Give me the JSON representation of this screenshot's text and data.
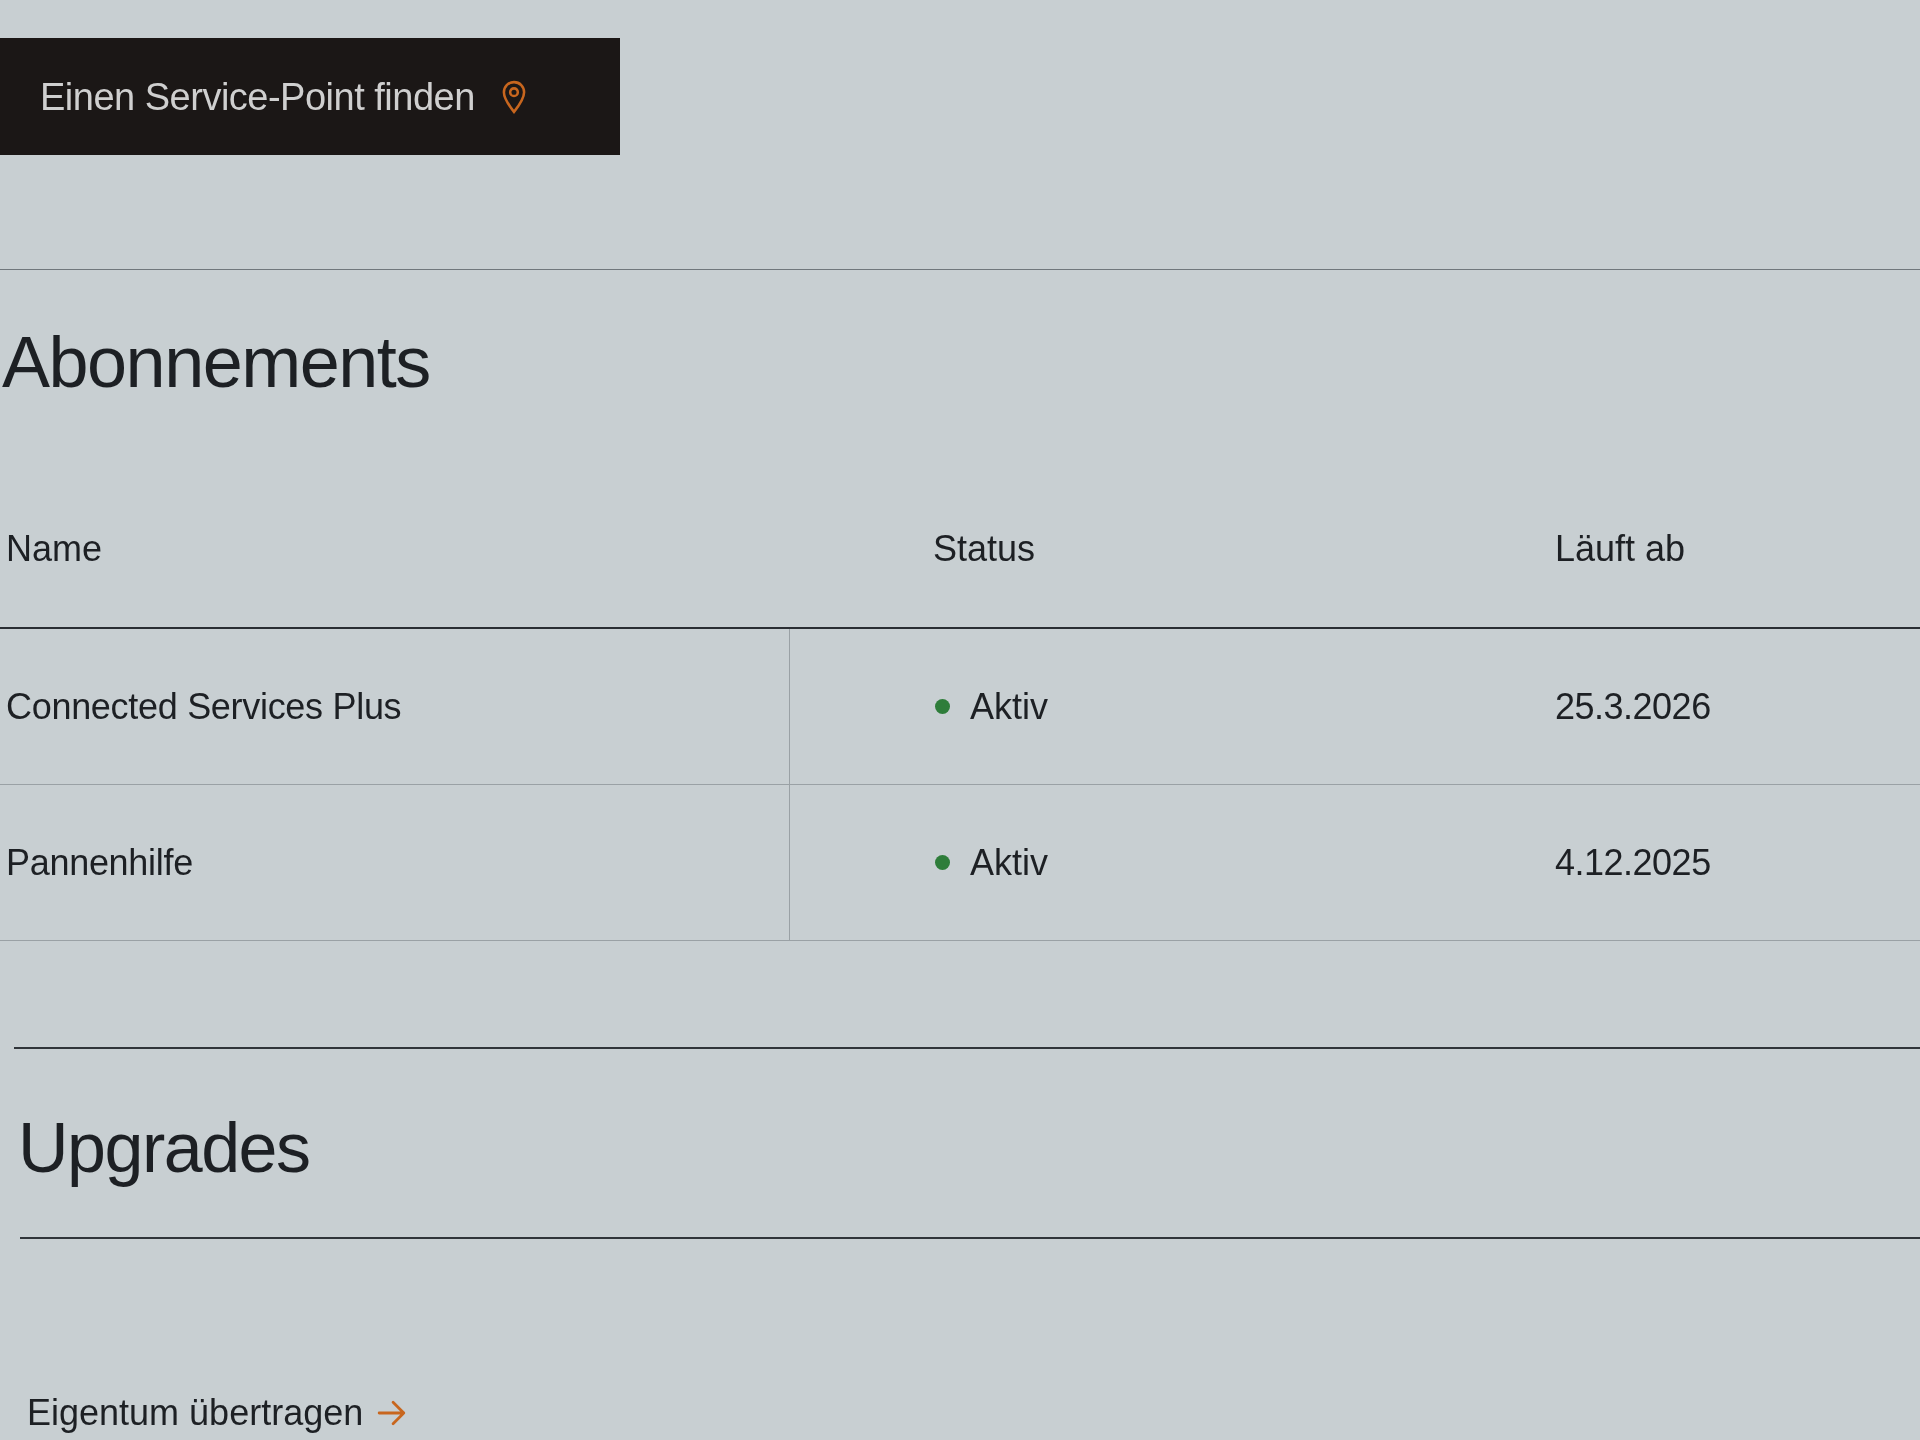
{
  "service_point_button": {
    "label": "Einen Service-Point finden"
  },
  "subscriptions": {
    "title": "Abonnements",
    "table": {
      "columns": [
        "Name",
        "Status",
        "Läuft ab"
      ],
      "rows": [
        {
          "name": "Connected Services Plus",
          "status": "Aktiv",
          "color": "#2e7d3a",
          "expires": "25.3.2026"
        },
        {
          "name": "Pannenhilfe",
          "status": "Aktiv",
          "color": "#2e7d3a",
          "expires": "4.12.2025"
        }
      ]
    }
  },
  "upgrades": {
    "title": "Upgrades"
  },
  "transfer_link": {
    "label": "Eigentum übertragen"
  }
}
